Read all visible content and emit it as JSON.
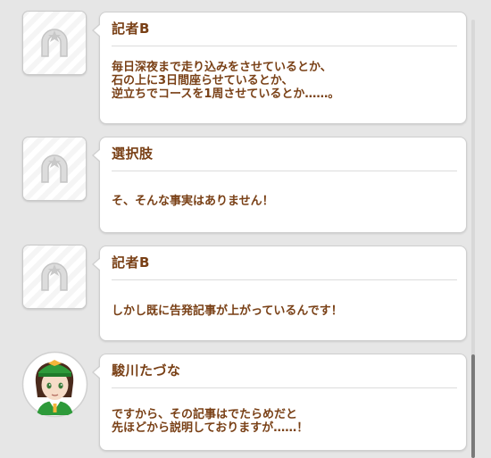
{
  "messages": [
    {
      "speaker": "記者B",
      "avatar": "placeholder-horseshoe-icon",
      "text": "毎日深夜まで走り込みをさせているとか、\n石の上に3日間座らせているとか、\n逆立ちでコースを1周させているとか……。"
    },
    {
      "speaker": "選択肢",
      "avatar": "placeholder-horseshoe-icon",
      "text": "そ、そんな事実はありません！"
    },
    {
      "speaker": "記者B",
      "avatar": "placeholder-horseshoe-icon",
      "text": "しかし既に告発記事が上がっているんです！"
    },
    {
      "speaker": "駿川たづな",
      "avatar": "character-portrait",
      "text": "ですから、その記事はでたらめだと\n先ほどから説明しておりますが……！"
    }
  ],
  "colors": {
    "text_brown": "#794016",
    "background": "#e6e6e6",
    "bubble": "#ffffff",
    "scroll_thumb": "#7a7a7a"
  }
}
